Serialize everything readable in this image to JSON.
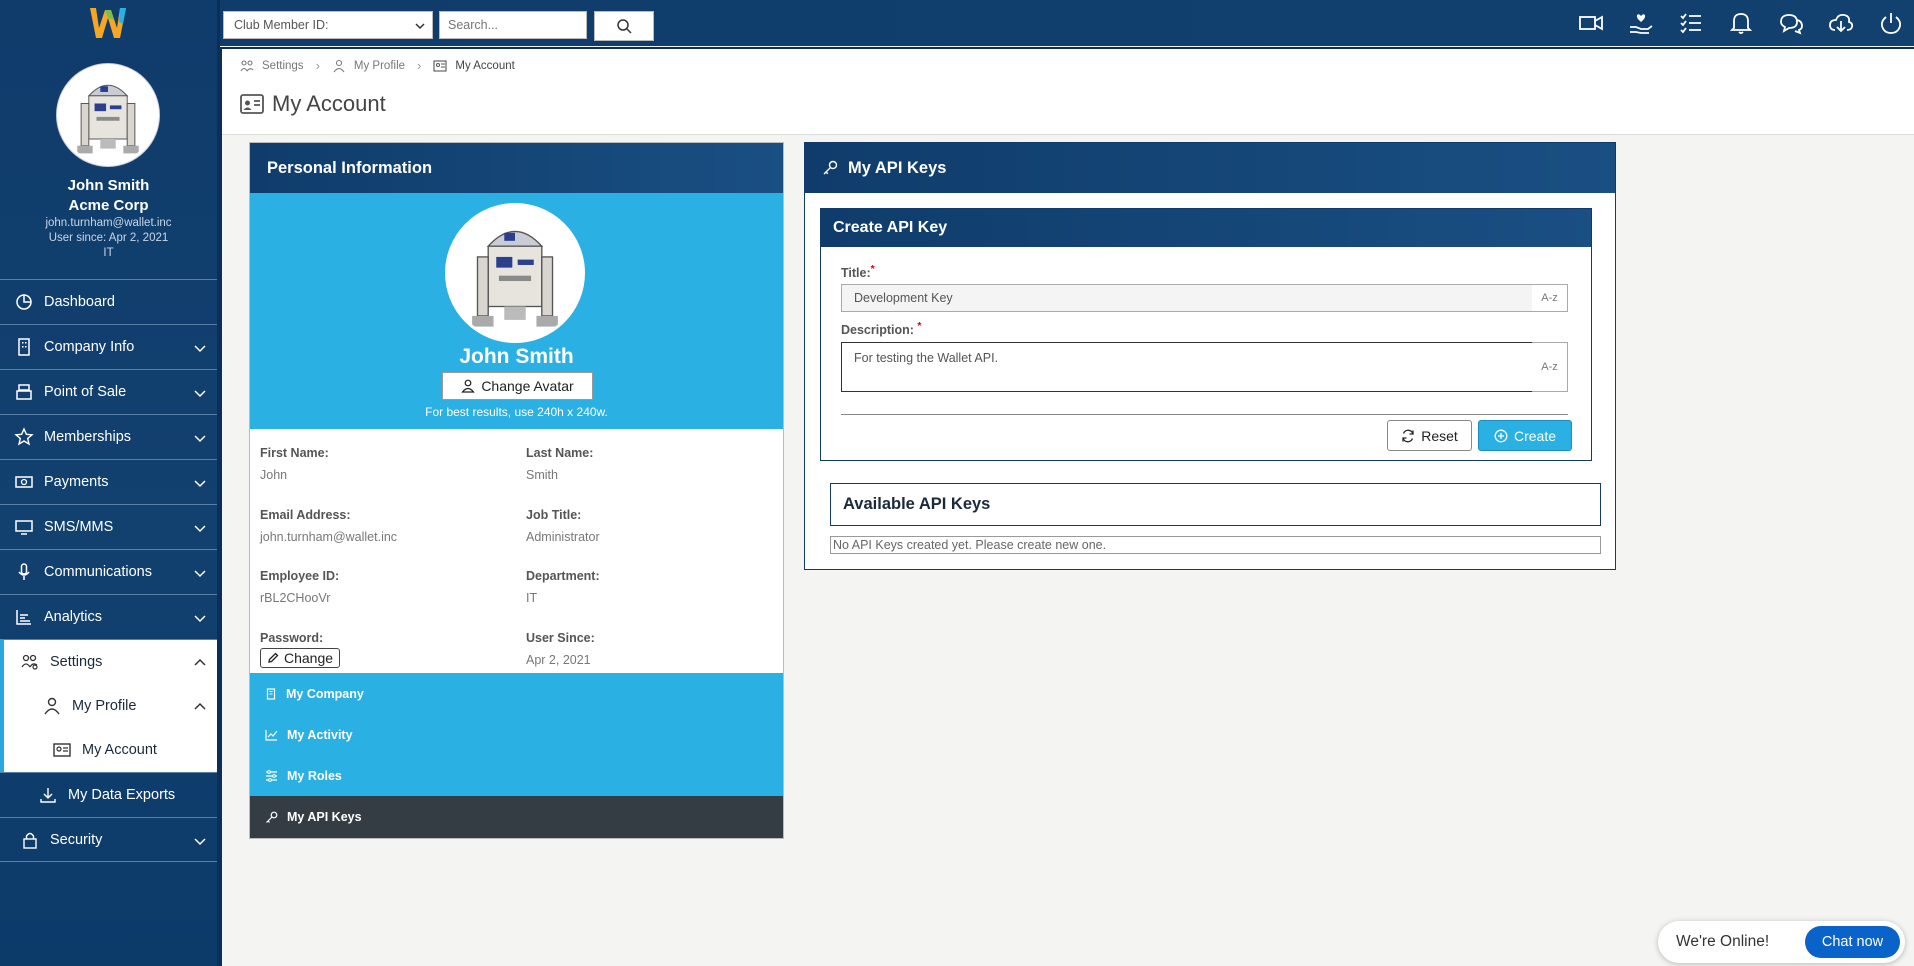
{
  "topbar": {
    "club_select": "Club Member ID:",
    "search_placeholder": "Search..."
  },
  "user": {
    "name": "John Smith",
    "company": "Acme Corp",
    "email": "john.turnham@wallet.inc",
    "since": "User since: Apr 2, 2021",
    "department": "IT"
  },
  "menu": {
    "dashboard": "Dashboard",
    "company_info": "Company Info",
    "point_of_sale": "Point of Sale",
    "memberships": "Memberships",
    "payments": "Payments",
    "sms_mms": "SMS/MMS",
    "communications": "Communications",
    "analytics": "Analytics",
    "settings": "Settings",
    "my_profile": "My Profile",
    "my_account": "My Account",
    "my_data_exports": "My Data Exports",
    "security": "Security"
  },
  "breadcrumb": [
    "Settings",
    "My Profile",
    "My Account"
  ],
  "page_title": "My Account",
  "personal": {
    "heading": "Personal Information",
    "name": "John Smith",
    "change_avatar": "Change Avatar",
    "hint": "For best results, use 240h x 240w.",
    "fields": {
      "first_name_label": "First Name:",
      "first_name": "John",
      "last_name_label": "Last Name:",
      "last_name": "Smith",
      "email_label": "Email Address:",
      "email": "john.turnham@wallet.inc",
      "job_title_label": "Job Title:",
      "job_title": "Administrator",
      "employee_id_label": "Employee ID:",
      "employee_id": "rBL2CHooVr",
      "department_label": "Department:",
      "department": "IT",
      "password_label": "Password:",
      "password_button": "Change",
      "user_since_label": "User Since:",
      "user_since": "Apr 2, 2021"
    },
    "links": [
      "My Company",
      "My Activity",
      "My Roles",
      "My API Keys"
    ]
  },
  "api": {
    "heading": "My API Keys",
    "create_heading": "Create API Key",
    "title_label": "Title:",
    "title_value": "Development Key",
    "desc_label": "Description:",
    "desc_value": "For testing the Wallet API.",
    "az": "A-z",
    "reset": "Reset",
    "create": "Create",
    "available_heading": "Available API Keys",
    "empty_message": "No API Keys created yet. Please create new one."
  },
  "chat": {
    "status": "We're Online!",
    "button": "Chat now"
  },
  "colors": {
    "navy": "#0f3c6b",
    "sky": "#2ab0e2",
    "dark": "#343c44",
    "chat_blue": "#0a63c9"
  }
}
